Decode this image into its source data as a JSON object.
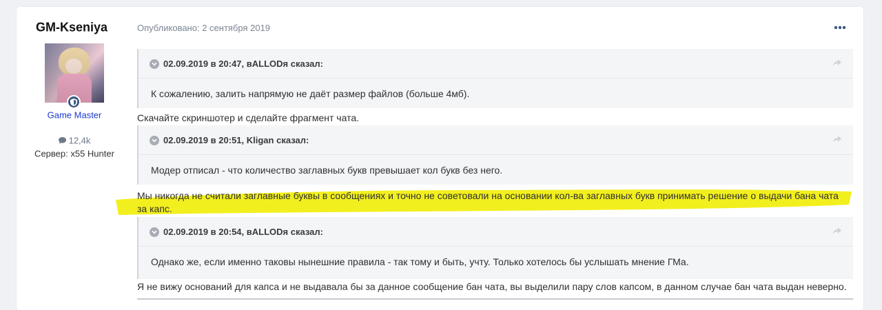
{
  "author": {
    "name": "GM-Kseniya",
    "rank": "Game Master",
    "post_count": "12,4k",
    "server": "Сервер: x55 Hunter"
  },
  "post": {
    "published": "Опубликовано: 2 сентября 2019",
    "quotes": [
      {
        "header": "02.09.2019 в 20:47, вALLODя сказал:",
        "body": "К сожалению, залить напрямую не даёт размер файлов (больше 4мб)."
      },
      {
        "header": "02.09.2019 в 20:51, Kligan сказал:",
        "body": "Модер отписал - что количество заглавных букв превышает кол букв без него."
      },
      {
        "header": "02.09.2019 в 20:54, вALLODя сказал:",
        "body": "Однако же, если именно таковы нынешние правила - так тому и быть, учту. Только хотелось бы услышать мнение ГМа."
      }
    ],
    "replies": [
      "Скачайте скриншотер и сделайте фрагмент чата.",
      "Мы никогда не считали заглавные буквы в сообщениях и точно не советовали на основании кол-ва заглавных букв принимать решение о выдачи бана чата за капс.",
      "Я не вижу оснований для капса и не выдавала бы за данное сообщение бан чата, вы выделили пару слов капсом, в данном случае бан чата выдан неверно."
    ]
  },
  "icons": {
    "badge": "shield-icon",
    "count": "comment-icon",
    "menu": "more-icon",
    "quote_toggle": "chevron-down-icon",
    "quote_share": "share-icon"
  },
  "colors": {
    "rank_link": "#1a3bd1",
    "highlight": "#f2ef1e",
    "badge": "#3d5a80"
  }
}
